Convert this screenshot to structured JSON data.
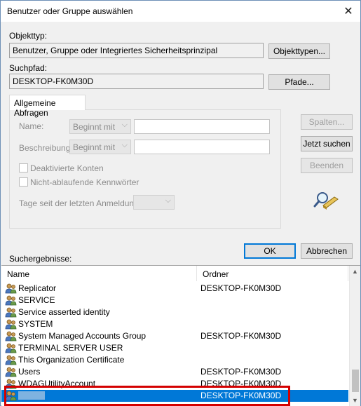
{
  "window": {
    "title": "Benutzer oder Gruppe auswählen",
    "close": "✕"
  },
  "object_type": {
    "label": "Objekttyp:",
    "value": "Benutzer, Gruppe oder Integriertes Sicherheitsprinzipal",
    "button": "Objekttypen..."
  },
  "search_path": {
    "label": "Suchpfad:",
    "value": "DESKTOP-FK0M30D",
    "button": "Pfade..."
  },
  "tab": {
    "label": "Allgemeine Abfragen"
  },
  "query": {
    "name_label": "Name:",
    "name_mode": "Beginnt mit",
    "description_label": "Beschreibung:",
    "description_mode": "Beginnt mit",
    "disabled_accounts": "Deaktivierte Konten",
    "non_expiring_passwords": "Nicht-ablaufende Kennwörter",
    "days_since_login": "Tage seit der letzten Anmeldung:"
  },
  "side_buttons": {
    "columns": "Spalten...",
    "search_now": "Jetzt suchen",
    "stop": "Beenden"
  },
  "footer": {
    "ok": "OK",
    "cancel": "Abbrechen",
    "results_label": "Suchergebnisse:"
  },
  "results": {
    "columns": [
      "Name",
      "Ordner"
    ],
    "rows": [
      {
        "name": "Replicator",
        "folder": "DESKTOP-FK0M30D"
      },
      {
        "name": "SERVICE",
        "folder": ""
      },
      {
        "name": "Service asserted identity",
        "folder": ""
      },
      {
        "name": "SYSTEM",
        "folder": ""
      },
      {
        "name": "System Managed Accounts Group",
        "folder": "DESKTOP-FK0M30D"
      },
      {
        "name": "TERMINAL SERVER USER",
        "folder": ""
      },
      {
        "name": "This Organization Certificate",
        "folder": ""
      },
      {
        "name": "Users",
        "folder": "DESKTOP-FK0M30D"
      },
      {
        "name": "WDAGUtilityAccount",
        "folder": "DESKTOP-FK0M30D"
      },
      {
        "name": "",
        "folder": "DESKTOP-FK0M30D"
      }
    ]
  },
  "colors": {
    "selection": "#0078d7",
    "highlight": "#d40000"
  }
}
